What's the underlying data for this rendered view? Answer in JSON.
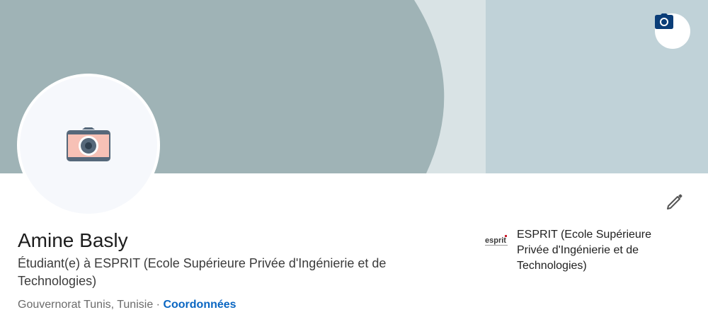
{
  "banner": {
    "colors": {
      "dark": "#9fb3b6",
      "light_band": "#d9e3e5",
      "right": "#c0d2d8"
    },
    "camera_icon": "camera-icon"
  },
  "profile": {
    "avatar_icon": "camera-placeholder-icon",
    "name": "Amine Basly",
    "headline": "Étudiant(e) à ESPRIT (Ecole Supérieure Privée d'Ingénierie et de Technologies)",
    "location": "Gouvernorat Tunis, Tunisie",
    "separator": "·",
    "contact_link": "Coordonnées",
    "edit_icon": "pencil-icon"
  },
  "education": {
    "school_name": "ESPRIT (Ecole Supérieure Privée d'Ingénierie et de Technologies)",
    "logo_text": "esprit"
  },
  "colors": {
    "link": "#0a66c2",
    "text": "#1d1d1d",
    "muted": "#6b6b6b"
  }
}
